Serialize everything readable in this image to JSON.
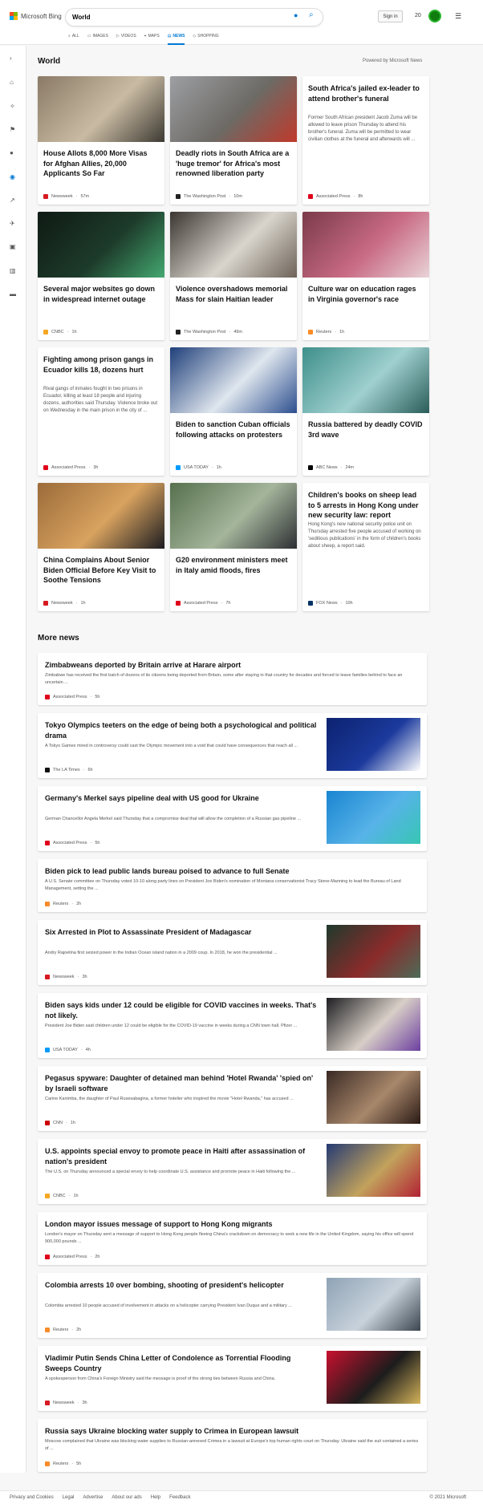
{
  "header": {
    "logo_text": "Microsoft Bing",
    "search_value": "World",
    "sign_in": "Sign in",
    "points": "20",
    "scopes": [
      {
        "label": "ALL",
        "icon": "search-icon",
        "glyph": "⌕"
      },
      {
        "label": "IMAGES",
        "icon": "image-icon",
        "glyph": "▭"
      },
      {
        "label": "VIDEOS",
        "icon": "video-icon",
        "glyph": "▷"
      },
      {
        "label": "MAPS",
        "icon": "map-icon",
        "glyph": "⌖"
      },
      {
        "label": "NEWS",
        "icon": "news-icon",
        "glyph": "▤",
        "active": true
      },
      {
        "label": "SHOPPING",
        "icon": "shopping-icon",
        "glyph": "◇"
      }
    ]
  },
  "sidebar": [
    {
      "icon": "expand-icon",
      "glyph": "›"
    },
    {
      "icon": "home-icon",
      "glyph": "⌂"
    },
    {
      "icon": "discover-icon",
      "glyph": "✧"
    },
    {
      "icon": "flag-icon",
      "glyph": "⚑"
    },
    {
      "icon": "location-icon",
      "glyph": "●"
    },
    {
      "icon": "globe-icon",
      "glyph": "◉",
      "active": true
    },
    {
      "icon": "chart-icon",
      "glyph": "↗"
    },
    {
      "icon": "rocket-icon",
      "glyph": "✈"
    },
    {
      "icon": "entertainment-icon",
      "glyph": "▣"
    },
    {
      "icon": "building-icon",
      "glyph": "▥"
    },
    {
      "icon": "card-icon",
      "glyph": "▬"
    }
  ],
  "world": {
    "title": "World",
    "powered_by": "Powered by Microsoft News",
    "cards": [
      {
        "title": "House Allots 8,000 More Visas for Afghan Allies, 20,000 Applicants So Far",
        "source": "Newsweek",
        "time": "57m",
        "has_image": true,
        "img_colors": [
          "#8a7a66",
          "#c9bba3",
          "#3d3a33"
        ],
        "src_color": "#d71921"
      },
      {
        "title": "Deadly riots in South Africa are a 'huge tremor' for Africa's most renowned liberation party",
        "source": "The Washington Post",
        "time": "10m",
        "has_image": true,
        "img_colors": [
          "#9d9fa3",
          "#6d6a65",
          "#c0392b"
        ],
        "src_color": "#222222"
      },
      {
        "title": "South Africa's jailed ex-leader to attend brother's funeral",
        "desc": "Former South African president Jacob Zuma will be allowed to leave prison Thursday to attend his brother's funeral. Zuma will be permitted to wear civilian clothes at the funeral and afterwards will ...",
        "source": "Associated Press",
        "time": "8h",
        "has_image": false,
        "src_color": "#e0001b"
      },
      {
        "title": "Several major websites go down in widespread internet outage",
        "source": "CNBC",
        "time": "1h",
        "has_image": true,
        "img_colors": [
          "#0f1a14",
          "#1d3b2a",
          "#44a870"
        ],
        "src_color": "#f5a623"
      },
      {
        "title": "Violence overshadows memorial Mass for slain Haitian leader",
        "source": "The Washington Post",
        "time": "49m",
        "has_image": true,
        "img_colors": [
          "#3b3631",
          "#d9d5cd",
          "#6d6258"
        ],
        "src_color": "#222222"
      },
      {
        "title": "Culture war on education rages in Virginia governor's race",
        "source": "Reuters",
        "time": "1h",
        "has_image": true,
        "img_colors": [
          "#7a3a4a",
          "#c96b84",
          "#e9d3d8"
        ],
        "src_color": "#fa8c28"
      },
      {
        "title": "Fighting among prison gangs in Ecuador kills 18, dozens hurt",
        "desc": "Rival gangs of inmates fought in two prisons in Ecuador, killing at least 18 people and injuring dozens, authorities said Thursday. Violence broke out on Wednesday in the main prison in the city of ...",
        "source": "Associated Press",
        "time": "3h",
        "has_image": false,
        "src_color": "#e0001b"
      },
      {
        "title": "Biden to sanction Cuban officials following attacks on protesters",
        "source": "USA TODAY",
        "time": "1h",
        "has_image": true,
        "img_colors": [
          "#1f3f7a",
          "#dfe6ee",
          "#2d4f8f"
        ],
        "src_color": "#009bff"
      },
      {
        "title": "Russia battered by deadly COVID 3rd wave",
        "source": "ABC News",
        "time": "24m",
        "has_image": true,
        "img_colors": [
          "#3e8f8a",
          "#9fd0cf",
          "#2a5d5a"
        ],
        "src_color": "#000000"
      },
      {
        "title": "China Complains About Senior Biden Official Before Key Visit to Soothe Tensions",
        "source": "Newsweek",
        "time": "1h",
        "has_image": true,
        "img_colors": [
          "#9b6b3a",
          "#d8a25f",
          "#1c1c20"
        ],
        "src_color": "#d71921"
      },
      {
        "title": "G20 environment ministers meet in Italy amid floods, fires",
        "source": "Associated Press",
        "time": "7h",
        "has_image": true,
        "img_colors": [
          "#56704d",
          "#a4b59b",
          "#2d2f33"
        ],
        "src_color": "#e0001b"
      },
      {
        "title": "Children's books on sheep lead to 5 arrests in Hong Kong under new security law: report",
        "desc": "Hong Kong's new national security police unit on Thursday arrested five people accused of working on 'seditious publications' in the form of children's books about sheep, a report said.",
        "source": "FOX News",
        "time": "10h",
        "has_image": false,
        "src_color": "#003366"
      }
    ]
  },
  "more_news": {
    "title": "More news",
    "items": [
      {
        "title": "Zimbabweans deported by Britain arrive at Harare airport",
        "desc": "Zimbabwe has received the first batch of dozens of its citizens being deported from Britain, some after staying in that country for decades and forced to leave families behind to face an uncertain ...",
        "source": "Associated Press",
        "time": "5h",
        "has_image": false,
        "src_color": "#e0001b"
      },
      {
        "title": "Tokyo Olympics teeters on the edge of being both a psychological and political drama",
        "desc": "A Tokyo Games mired in controversy could cast the Olympic movement into a void that could have consequences that reach all ...",
        "source": "The LA Times",
        "time": "6h",
        "has_image": true,
        "img_colors": [
          "#0d2270",
          "#1b3a9c",
          "#ffffff"
        ],
        "src_color": "#111111"
      },
      {
        "title": "Germany's Merkel says pipeline deal with US good for Ukraine",
        "desc": "German Chancellor Angela Merkel said Thursday that a compromise deal that will allow the completion of a Russian gas pipeline ...",
        "source": "Associated Press",
        "time": "5h",
        "has_image": true,
        "img_colors": [
          "#1a85d1",
          "#57b3e8",
          "#37c6b3"
        ],
        "src_color": "#e0001b"
      },
      {
        "title": "Biden pick to lead public lands bureau poised to advance to full Senate",
        "desc": "A U.S. Senate committee on Thursday voted 10-10 along party lines on President Joe Biden's nomination of Montana conservationist Tracy Stone-Manning to lead the Bureau of Land Management, setting the ...",
        "source": "Reuters",
        "time": "2h",
        "has_image": false,
        "src_color": "#fa8c28"
      },
      {
        "title": "Six Arrested in Plot to Assassinate President of Madagascar",
        "desc": "Andry Rajoelina first seized power in the Indian Ocean island nation in a 2009 coup. In 2018, he won the presidential ...",
        "source": "Newsweek",
        "time": "3h",
        "has_image": true,
        "img_colors": [
          "#1f3a2c",
          "#8a2b2b",
          "#4d6b58"
        ],
        "src_color": "#d71921"
      },
      {
        "title": "Biden says kids under 12 could be eligible for COVID vaccines in weeks. That's not likely.",
        "desc": "President Joe Biden said children under 12 could be eligible for the COVID-19 vaccine in weeks during a CNN town hall. Pfizer ...",
        "source": "USA TODAY",
        "time": "4h",
        "has_image": true,
        "img_colors": [
          "#1e1e22",
          "#d8cfc7",
          "#6c3fa0"
        ],
        "src_color": "#009bff"
      },
      {
        "title": "Pegasus spyware: Daughter of detained man behind 'Hotel Rwanda' 'spied on' by Israeli software",
        "desc": "Carine Kanimba, the daughter of Paul Rusesabagina, a former hotelier who inspired the movie \"Hotel Rwanda,\" has accused ...",
        "source": "CNN",
        "time": "1h",
        "has_image": true,
        "img_colors": [
          "#3a2a24",
          "#a8876b",
          "#2a1a15"
        ],
        "src_color": "#cc0000"
      },
      {
        "title": "U.S. appoints special envoy to promote peace in Haiti after assassination of nation's president",
        "desc": "The U.S. on Thursday announced a special envoy to help coordinate U.S. assistance and promote peace in Haiti following the ...",
        "source": "CNBC",
        "time": "1h",
        "has_image": true,
        "img_colors": [
          "#253b74",
          "#c2a25c",
          "#b22234"
        ],
        "src_color": "#f5a623"
      },
      {
        "title": "London mayor issues message of support to Hong Kong migrants",
        "desc": "London's mayor on Thursday sent a message of support to Hong Kong people fleeing China's crackdown on democracy to seek a new life in the United Kingdom, saying his office will spend 900,000 pounds ...",
        "source": "Associated Press",
        "time": "2h",
        "has_image": false,
        "src_color": "#e0001b"
      },
      {
        "title": "Colombia arrests 10 over bombing, shooting of president's helicopter",
        "desc": "Colombia arrested 10 people accused of involvement in attacks on a helicopter carrying President Ivan Duque and a military ...",
        "source": "Reuters",
        "time": "2h",
        "has_image": true,
        "img_colors": [
          "#8fa3b6",
          "#c8d2db",
          "#3b4650"
        ],
        "src_color": "#fa8c28"
      },
      {
        "title": "Vladimir Putin Sends China Letter of Condolence as Torrential Flooding Sweeps Country",
        "desc": "A spokesperson from China's Foreign Ministry said the message is proof of the strong ties between Russia and China.",
        "source": "Newsweek",
        "time": "3h",
        "has_image": true,
        "img_colors": [
          "#c8102e",
          "#1c1c1c",
          "#d4b35a"
        ],
        "src_color": "#d71921"
      },
      {
        "title": "Russia says Ukraine blocking water supply to Crimea in European lawsuit",
        "desc": "Moscow complained that Ukraine was blocking water supplies to Russian-annexed Crimea in a lawsuit at Europe's top human rights court on Thursday. Ukraine said the suit contained a series of ...",
        "source": "Reuters",
        "time": "5h",
        "has_image": false,
        "src_color": "#fa8c28"
      }
    ]
  },
  "footer": {
    "links": [
      "Privacy and Cookies",
      "Legal",
      "Advertise",
      "About our ads",
      "Help",
      "Feedback"
    ],
    "copyright": "© 2021 Microsoft"
  }
}
